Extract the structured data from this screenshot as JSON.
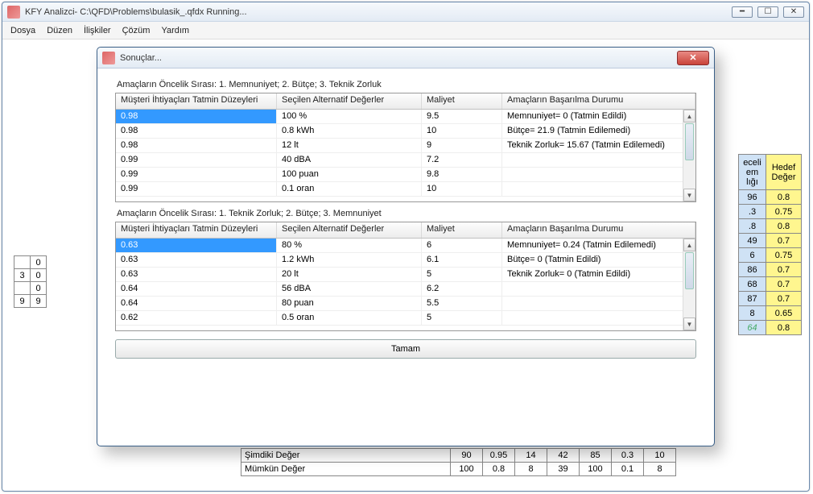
{
  "mainWindow": {
    "title": "KFY Analizci- C:\\QFD\\Problems\\bulasik_.qfdx Running...",
    "winButtons": {
      "min": "━",
      "max": "☐",
      "close": "✕"
    }
  },
  "menu": [
    "Dosya",
    "Düzen",
    "İlişkiler",
    "Çözüm",
    "Yardım"
  ],
  "dialog": {
    "title": "Sonuçlar...",
    "okLabel": "Tamam",
    "section1Label": "Amaçların Öncelik Sırası: 1. Memnuniyet; 2. Bütçe; 3. Teknik Zorluk",
    "section2Label": "Amaçların Öncelik Sırası: 1. Teknik Zorluk; 2. Bütçe; 3. Memnuniyet",
    "columns": [
      "Müşteri İhtiyaçları Tatmin Düzeyleri",
      "Seçilen Alternatif Değerler",
      "Maliyet",
      "Amaçların Başarılma Durumu"
    ],
    "grid1": [
      {
        "a": "0.98",
        "b": "100 %",
        "c": "9.5",
        "d": "Memnuniyet= 0 (Tatmin Edildi)"
      },
      {
        "a": "0.98",
        "b": "0.8 kWh",
        "c": "10",
        "d": "Bütçe= 21.9 (Tatmin Edilemedi)"
      },
      {
        "a": "0.98",
        "b": "12 lt",
        "c": "9",
        "d": "Teknik Zorluk= 15.67 (Tatmin Edilemedi)"
      },
      {
        "a": "0.99",
        "b": "40 dBA",
        "c": "7.2",
        "d": ""
      },
      {
        "a": "0.99",
        "b": "100 puan",
        "c": "9.8",
        "d": ""
      },
      {
        "a": "0.99",
        "b": "0.1 oran",
        "c": "10",
        "d": ""
      }
    ],
    "grid2": [
      {
        "a": "0.63",
        "b": "80 %",
        "c": "6",
        "d": "Memnuniyet= 0.24 (Tatmin Edilemedi)"
      },
      {
        "a": "0.63",
        "b": "1.2 kWh",
        "c": "6.1",
        "d": "Bütçe= 0 (Tatmin Edildi)"
      },
      {
        "a": "0.63",
        "b": "20 lt",
        "c": "5",
        "d": "Teknik Zorluk= 0 (Tatmin Edildi)"
      },
      {
        "a": "0.64",
        "b": "56 dBA",
        "c": "6.2",
        "d": ""
      },
      {
        "a": "0.64",
        "b": "80 puan",
        "c": "5.5",
        "d": ""
      },
      {
        "a": "0.62",
        "b": "0.5 oran",
        "c": "5",
        "d": ""
      }
    ]
  },
  "bgLeft": [
    [
      "",
      "0"
    ],
    [
      "3",
      "0"
    ],
    [
      "",
      "0"
    ],
    [
      "9",
      "9"
    ]
  ],
  "bgRightHeaders": {
    "a": "eceli\nem\nlığı",
    "b": "Hedef\nDeğer"
  },
  "bgRight": [
    {
      "a": "96",
      "b": "0.8"
    },
    {
      "a": ".3",
      "b": "0.75"
    },
    {
      "a": ".8",
      "b": "0.8"
    },
    {
      "a": "49",
      "b": "0.7"
    },
    {
      "a": "6",
      "b": "0.75"
    },
    {
      "a": "86",
      "b": "0.7"
    },
    {
      "a": "68",
      "b": "0.7"
    },
    {
      "a": "87",
      "b": "0.7"
    },
    {
      "a": "8",
      "b": "0.65"
    },
    {
      "a": "64",
      "b": "0.8",
      "italic": true
    }
  ],
  "bgBottom": [
    {
      "label": "Şimdiki Değer",
      "v": [
        "90",
        "0.95",
        "14",
        "42",
        "85",
        "0.3",
        "10"
      ]
    },
    {
      "label": "Mümkün Değer",
      "v": [
        "100",
        "0.8",
        "8",
        "39",
        "100",
        "0.1",
        "8"
      ]
    }
  ]
}
